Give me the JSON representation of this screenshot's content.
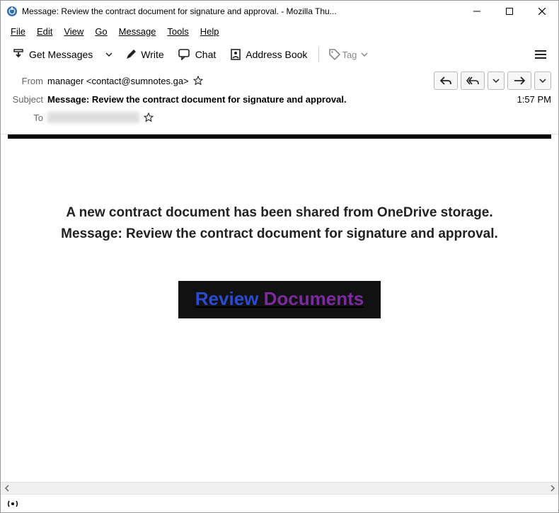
{
  "window": {
    "title": "Message: Review the contract document for signature and approval. - Mozilla Thu..."
  },
  "menu": {
    "file": "File",
    "edit": "Edit",
    "view": "View",
    "go": "Go",
    "message": "Message",
    "tools": "Tools",
    "help": "Help"
  },
  "toolbar": {
    "get_messages": "Get Messages",
    "write": "Write",
    "chat": "Chat",
    "address_book": "Address Book",
    "tag": "Tag"
  },
  "header": {
    "from_label": "From",
    "from_value": "manager <contact@sumnotes.ga>",
    "subject_label": "Subject",
    "subject_value": "Message: Review the contract document for signature and approval.",
    "to_label": "To",
    "time": "1:57 PM"
  },
  "body": {
    "line1": "A new contract document has been shared from OneDrive storage.",
    "line2": "Message: Review the contract document for signature and approval.",
    "button_word1": "Review",
    "button_word2": "Documents"
  }
}
